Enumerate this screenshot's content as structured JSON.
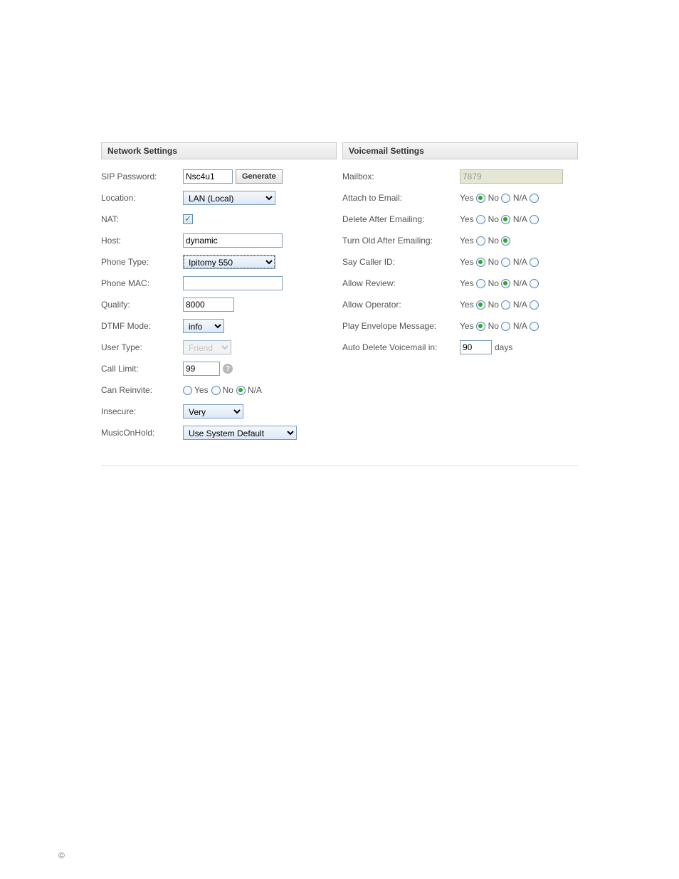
{
  "network": {
    "title": "Network Settings",
    "sip_password": {
      "label": "SIP Password:",
      "value": "Nsc4u1",
      "button": "Generate"
    },
    "location": {
      "label": "Location:",
      "value": "LAN (Local)"
    },
    "nat": {
      "label": "NAT:",
      "checked": true
    },
    "host": {
      "label": "Host:",
      "value": "dynamic"
    },
    "phone_type": {
      "label": "Phone Type:",
      "value": "Ipitomy 550"
    },
    "phone_mac": {
      "label": "Phone MAC:",
      "value": ""
    },
    "qualify": {
      "label": "Qualify:",
      "value": "8000"
    },
    "dtmf_mode": {
      "label": "DTMF Mode:",
      "value": "info"
    },
    "user_type": {
      "label": "User Type:",
      "value": "Friend"
    },
    "call_limit": {
      "label": "Call Limit:",
      "value": "99"
    },
    "can_reinvite": {
      "label": "Can Reinvite:",
      "yes": "Yes",
      "no": "No",
      "na": "N/A",
      "selected": "na"
    },
    "insecure": {
      "label": "Insecure:",
      "value": "Very"
    },
    "moh": {
      "label": "MusicOnHold:",
      "value": "Use System Default"
    }
  },
  "voicemail": {
    "title": "Voicemail Settings",
    "mailbox": {
      "label": "Mailbox:",
      "value": "7879"
    },
    "yes": "Yes",
    "no": "No",
    "na": "N/A",
    "attach_email": {
      "label": "Attach to Email:",
      "selected": "yes",
      "has_na": true
    },
    "delete_after": {
      "label": "Delete After Emailing:",
      "selected": "no",
      "has_na": true
    },
    "turn_old": {
      "label": "Turn Old After Emailing:",
      "selected": "no",
      "has_na": false
    },
    "say_caller": {
      "label": "Say Caller ID:",
      "selected": "yes",
      "has_na": true
    },
    "allow_review": {
      "label": "Allow Review:",
      "selected": "no",
      "has_na": true
    },
    "allow_operator": {
      "label": "Allow Operator:",
      "selected": "yes",
      "has_na": true
    },
    "play_envelope": {
      "label": "Play Envelope Message:",
      "selected": "yes",
      "has_na": true
    },
    "auto_delete": {
      "label": "Auto Delete Voicemail in:",
      "value": "90",
      "unit": "days"
    }
  },
  "copyright": "©"
}
